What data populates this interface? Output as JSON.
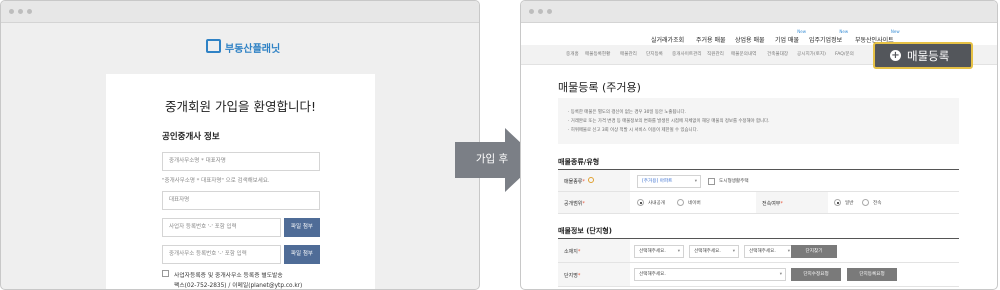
{
  "left_window": {
    "logo_text": "부동산플래닛",
    "heading": "중개회원 가입을 환영합니다!",
    "section_title": "공인중개사 정보",
    "office_name_placeholder": "중개사무소명 * 대표자명",
    "office_name_hint": "\"중개사무소명 * 대표자명\" 으로 검색해보세요.",
    "rep_name_placeholder": "대표자명",
    "biz_reg_placeholder": "사업자 등록번호 '-' 포함 입력",
    "office_reg_placeholder": "중개사무소 등록번호 '-' 포함 입력",
    "attach_label": "파일 첨부",
    "consent_line1": "사업자등록증 및 중개사무소 등록증 별도발송",
    "consent_line2": "팩스(02-752-2835) / 이메일(planet@ytp.co.kr)"
  },
  "arrow": {
    "label": "가입 후"
  },
  "right_window": {
    "nav": [
      {
        "label": "실거래가조회",
        "is_new": false
      },
      {
        "label": "주거용 매물",
        "is_new": false
      },
      {
        "label": "상업용 매물",
        "is_new": false
      },
      {
        "label": "기업 매물",
        "is_new": true
      },
      {
        "label": "입주기업정보",
        "is_new": true
      },
      {
        "label": "부동산인사이트",
        "is_new": true
      }
    ],
    "new_badge": "New",
    "subnav": [
      "중개홈",
      "매물등록현황",
      "매물관리",
      "단지등록",
      "중개사이트관리",
      "직원관리",
      "매물문의내역",
      "건축물대장",
      "공시지가(토지)",
      "FAQ/문의"
    ],
    "highlight_button": "매물등록",
    "page_title": "매물등록 (주거용)",
    "notices": [
      "· 등록한 매물은 별도의 갱신이 없는 경우 30일 동안 노출됩니다.",
      "· 거래완료 또는 가격 변경 등 매물정보의 변화를 발생된 시점에 지체없이 해당 매물의 정보를 수정해야 합니다.",
      "· 허위매물로 신고 3회 이상 적발 시 서비스 이용이 제한될 수 있습니다."
    ],
    "section_type": "매물종류/유형",
    "type_label": "매물종류",
    "type_value": "[주거용] 아파트",
    "type_check_label": "도시형생활주택",
    "disclosure_label": "공개범위",
    "disclosure_opt1": "사내공개",
    "disclosure_opt2": "네이버",
    "lease_label": "전속여부",
    "lease_opt1": "일반",
    "lease_opt2": "전속",
    "section_complex": "매물정보 (단지형)",
    "location_label": "소재지",
    "select_placeholder": "선택해주세요.",
    "find_complex_btn": "단지찾기",
    "complex_label": "단지명",
    "complex_edit_btn": "단지수정요청",
    "complex_reg_btn": "단지등록요청",
    "required_mark": "*"
  },
  "colors": {
    "brand_blue": "#2f82c5",
    "attach_button": "#4f6c97",
    "arrow": "#7b7f86",
    "highlight_border": "#e6c145",
    "highlight_bg": "#53565b",
    "required": "#e8553a"
  }
}
